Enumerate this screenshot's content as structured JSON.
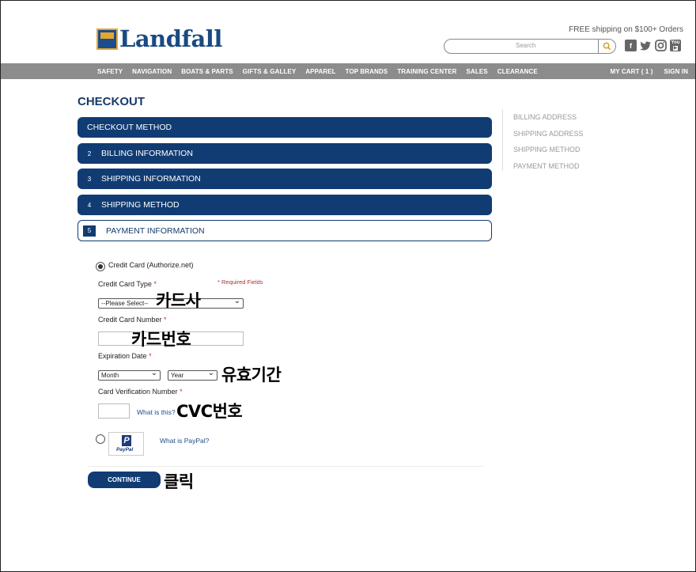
{
  "header": {
    "logo_text": "Landfall",
    "free_shipping": "FREE shipping on $100+ Orders",
    "search_placeholder": "Search",
    "social": [
      "facebook",
      "twitter",
      "instagram",
      "youtube"
    ],
    "youtube_label": "You"
  },
  "nav": {
    "items": [
      "SAFETY",
      "NAVIGATION",
      "BOATS & PARTS",
      "GIFTS & GALLEY",
      "APPAREL",
      "TOP BRANDS",
      "TRAINING CENTER",
      "SALES",
      "CLEARANCE"
    ],
    "my_cart": "MY CART ( 1 )",
    "sign_in": "SIGN IN"
  },
  "checkout": {
    "title": "CHECKOUT",
    "steps": [
      {
        "num": "",
        "label": "CHECKOUT METHOD"
      },
      {
        "num": "2",
        "label": "BILLING INFORMATION"
      },
      {
        "num": "3",
        "label": "SHIPPING INFORMATION"
      },
      {
        "num": "4",
        "label": "SHIPPING METHOD"
      },
      {
        "num": "5",
        "label": "PAYMENT INFORMATION"
      }
    ],
    "progress": [
      "BILLING ADDRESS",
      "SHIPPING ADDRESS",
      "SHIPPING METHOD",
      "PAYMENT METHOD"
    ]
  },
  "payment": {
    "credit_card_option": "Credit Card (Authorize.net)",
    "card_type_label": "Credit Card Type",
    "required_fields": "* Required Fields",
    "card_type_value": "--Please Select--",
    "card_number_label": "Credit Card Number",
    "expiration_label": "Expiration Date",
    "month_value": "Month",
    "year_value": "Year",
    "cvv_label": "Card Verification Number",
    "what_is_this": "What is this?",
    "paypal_logo_text": "PayPal",
    "what_is_paypal": "What is PayPal?",
    "continue_label": "CONTINUE",
    "required_marker": "*"
  },
  "annotations": {
    "card_company": "카드사",
    "card_number": "카드번호",
    "expiry": "유효기간",
    "cvc": "CVC번호",
    "click": "클릭"
  },
  "colors": {
    "primary": "#113c73",
    "nav_bg": "#8c8c8c",
    "logo_gold": "#e2a72e",
    "search_icon": "#d4a017"
  }
}
